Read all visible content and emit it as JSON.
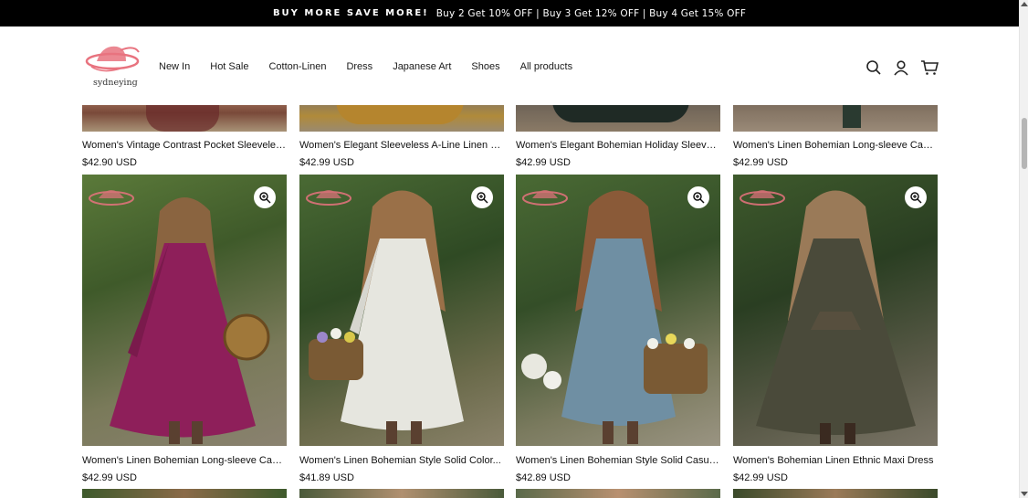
{
  "announcement": {
    "strong": "BUY MORE SAVE MORE!",
    "text": "Buy 2 Get 10% OFF | Buy 3 Get 12% OFF | Buy 4 Get 15% OFF"
  },
  "brand": {
    "name": "sydneying",
    "accent": "#e8737f"
  },
  "nav": [
    {
      "label": "New In"
    },
    {
      "label": "Hot Sale"
    },
    {
      "label": "Cotton-Linen"
    },
    {
      "label": "Dress"
    },
    {
      "label": "Japanese Art"
    },
    {
      "label": "Shoes"
    },
    {
      "label": "All products"
    }
  ],
  "header_icons": [
    "search-icon",
    "account-icon",
    "cart-icon"
  ],
  "products_row1": [
    {
      "title": "Women's Vintage Contrast Pocket Sleeveless...",
      "price": "$42.90 USD"
    },
    {
      "title": "Women's Elegant Sleeveless A-Line Linen Maxi...",
      "price": "$42.99 USD"
    },
    {
      "title": "Women's Elegant Bohemian Holiday Sleeveless...",
      "price": "$42.99 USD"
    },
    {
      "title": "Women's Linen Bohemian Long-sleeve Casual...",
      "price": "$42.99 USD"
    }
  ],
  "products_row2": [
    {
      "title": "Women's Linen Bohemian Long-sleeve Casual...",
      "price": "$42.99 USD",
      "color": "#8e1f5a"
    },
    {
      "title": "Women's Linen Bohemian Style Solid Color...",
      "price": "$41.89 USD",
      "color": "#e6e6df"
    },
    {
      "title": "Women's Linen Bohemian Style Solid Casual...",
      "price": "$42.89 USD",
      "color": "#6f8fa3"
    },
    {
      "title": "Women's Bohemian Linen Ethnic Maxi Dress",
      "price": "$42.99 USD",
      "color": "#4a4a3a"
    }
  ]
}
